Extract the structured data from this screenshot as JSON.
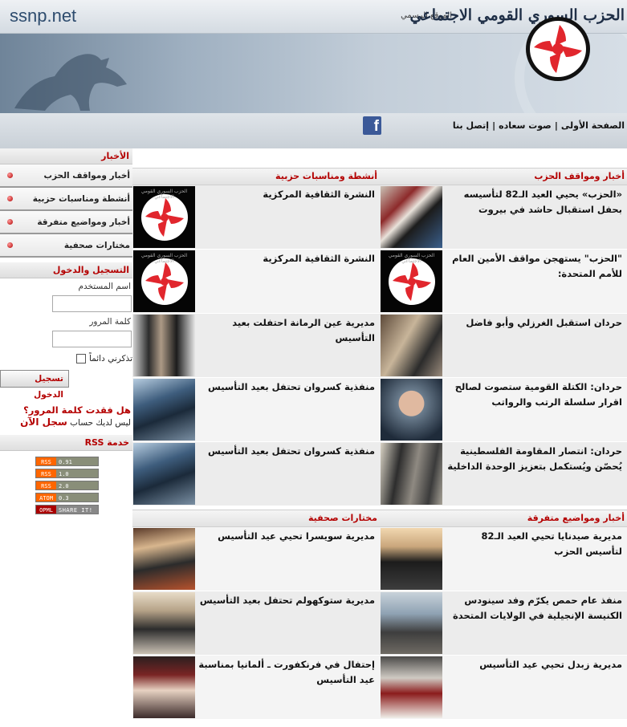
{
  "header": {
    "domain": "ssnp.net",
    "party_name": "الحزب السوري القومي الاجتماعي",
    "official_site": "الموقع الرسمي"
  },
  "nav": {
    "items": [
      "الصفحة الأولى",
      "صوت سعاده",
      "إتصل بنا"
    ],
    "facebook": "f"
  },
  "sidebar": {
    "news_title": "الأخبار",
    "news_items": [
      "أخبار ومواقف الحزب",
      "أنشطة ومناسبات حزبية",
      "أخبار ومواضيع متفرقة",
      "مختارات صحفية"
    ],
    "login_title": "التسجيل والدخول",
    "username_label": "اسم المستخدم",
    "password_label": "كلمة المرور",
    "remember_label": "تذكرني دائماً",
    "login_button": "تسجيل الدخول",
    "forgot": "هل فقدت كلمة المرور؟",
    "no_account": "ليس لديك حساب",
    "register": "سجل الآن",
    "rss_title": "خدمة RSS",
    "rss_badges": [
      {
        "left": "RSS",
        "right": "0.91"
      },
      {
        "left": "RSS",
        "right": "1.0"
      },
      {
        "left": "RSS",
        "right": "2.0"
      },
      {
        "left": "ATOM",
        "right": "0.3"
      },
      {
        "left": "OPML",
        "right": "SHARE IT!"
      }
    ]
  },
  "section1": {
    "right_title": "أخبار ومواقف الحزب",
    "left_title": "أنشطة ومناسبات حزبية",
    "right_items": [
      "«الحزب» يحيي العيد الـ82 لتأسيسه بحفل استقبال حاشد في بيروت",
      "\"الحزب\" يستهجن مواقف الأمين العام للأمم المتحدة:",
      "حردان استقبل الغرزلي وأبو فاضل",
      "حردان: الكتلة القومية ستصوت لصالح اقرار سلسلة الرتب والرواتب",
      "حردان: انتصار المقاومة الفلسطينية يُحصّن ويُستكمل بتعزيز الوحدة الداخلية"
    ],
    "left_items": [
      "النشرة الثقافية المركزية",
      "النشرة الثقافية المركزية",
      "مديرية عين الرمانة احتفلت بعيد التأسيس",
      "منفذية كسروان تحتفل بعيد التأسيس",
      "منفذية كسروان تحتفل بعيد التأسيس"
    ],
    "logo_caption": "الحزب السوري القومي الاجتماعي"
  },
  "section2": {
    "right_title": "أخبار ومواضيع متفرقة",
    "left_title": "مختارات صحفية",
    "right_items": [
      "مديرية صيدنايا تحيي العيد الـ82 لتأسيس الحزب",
      "منفذ عام حمص يكرّم وفد سينودس الكنيسة الإنجيلية في الولايات المتحدة",
      "مديرية زبدل تحيي عيد التأسيس"
    ],
    "left_items": [
      "مديرية سويسرا تحيي عيد التأسيس",
      "مديرية ستوكهولم تحتفل بعيد التأسيس",
      "إحتفال في فرنكفورت ـ ألمانيا بمناسبة عيد التأسيس"
    ]
  },
  "colors": {
    "accent": "#b40000",
    "logo_red": "#e1262d"
  }
}
